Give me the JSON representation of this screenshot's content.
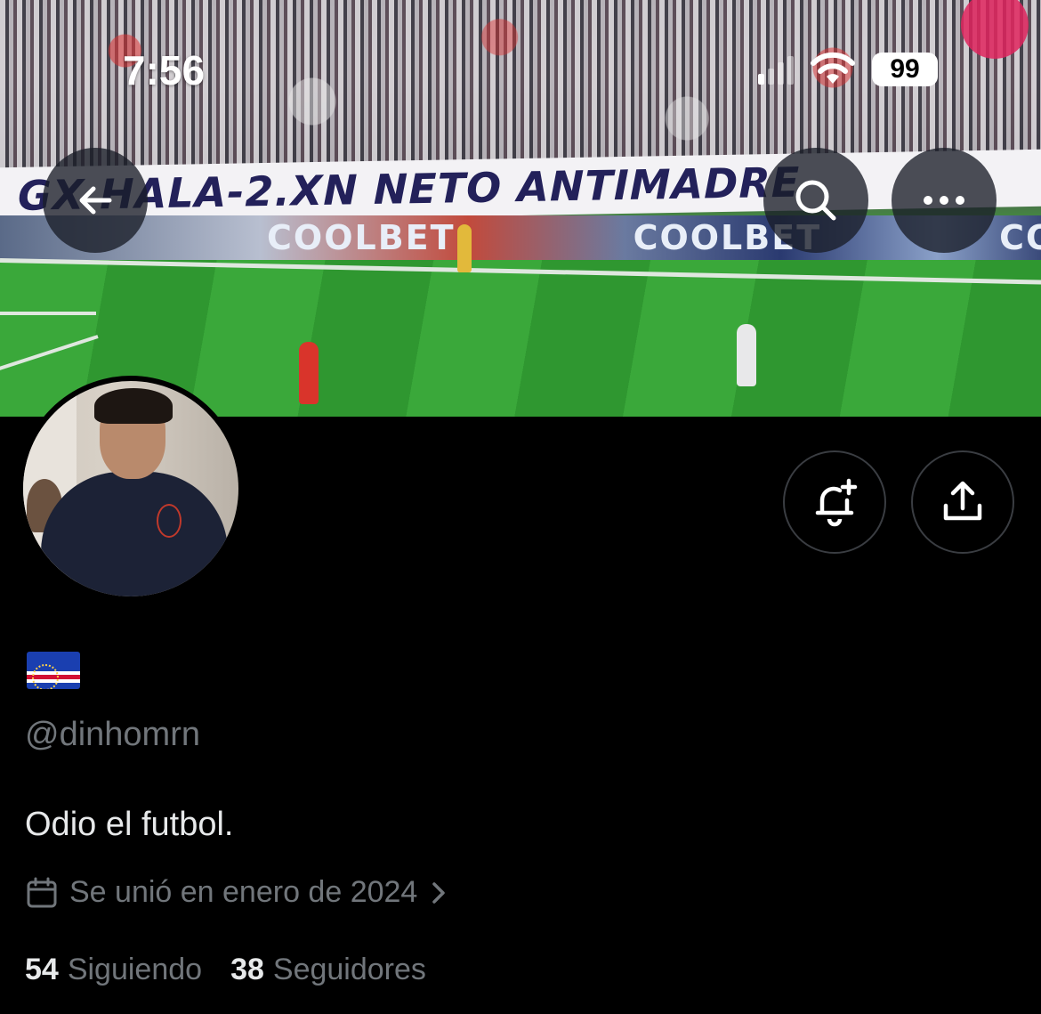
{
  "status_bar": {
    "time": "7:56",
    "battery": "99"
  },
  "banner": {
    "banner_text": "GX  HALA-2.XN NETO ANTIMADRE",
    "ad_text": [
      "COOLBET",
      "COOLBET",
      "COOLBET"
    ]
  },
  "header_actions": {
    "back_icon": "arrow-left-icon",
    "search_icon": "search-icon",
    "more_icon": "more-horizontal-icon"
  },
  "profile_actions": {
    "notify_icon": "bell-plus-icon",
    "share_icon": "share-icon"
  },
  "profile": {
    "display_name_flag": "🇨🇻",
    "handle": "@dinhomrn",
    "bio": "Odio el futbol.",
    "joined": "Se unió en enero de 2024",
    "following_count": "54",
    "following_label": "Siguiendo",
    "followers_count": "38",
    "followers_label": "Seguidores"
  },
  "colors": {
    "background": "#000000",
    "text_primary": "#e7e9ea",
    "text_secondary": "#71767b",
    "button_border": "#3a3d42"
  }
}
